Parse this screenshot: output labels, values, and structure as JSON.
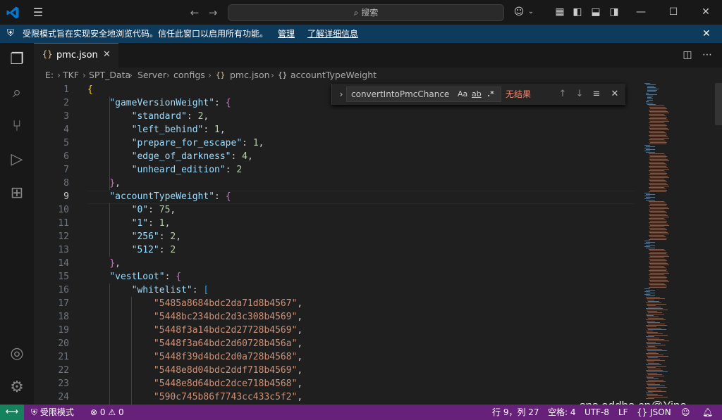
{
  "titlebar": {
    "search_placeholder": "搜索",
    "colors": {
      "logo": "#0078d4"
    }
  },
  "banner": {
    "message": "受限模式旨在实现安全地浏览代码。信任此窗口以启用所有功能。",
    "manage_link": "管理",
    "learn_more_link": "了解详细信息"
  },
  "tabs": [
    {
      "label": "pmc.json",
      "icon_text": "{}"
    }
  ],
  "breadcrumb": {
    "parts": [
      "E:",
      "TKF",
      "SPT_Data",
      "Server",
      "configs",
      "pmc.json",
      "accountTypeWeight"
    ]
  },
  "find": {
    "query": "convertIntoPmcChance",
    "case_label": "Aa",
    "word_label": "ab",
    "regex_label": ".*",
    "result": "无结果"
  },
  "editor": {
    "lines": [
      1,
      2,
      3,
      4,
      5,
      6,
      7,
      8,
      9,
      10,
      11,
      12,
      13,
      14,
      15,
      16,
      17,
      18,
      19,
      20,
      21,
      22,
      23,
      24
    ],
    "current_line": 9,
    "code": [
      "{",
      "\"gameVersionWeight\": {",
      "\"standard\": 2,",
      "\"left_behind\": 1,",
      "\"prepare_for_escape\": 1,",
      "\"edge_of_darkness\": 4,",
      "\"unheard_edition\": 2",
      "},",
      "\"accountTypeWeight\": {",
      "\"0\": 75,",
      "\"1\": 1,",
      "\"256\": 2,",
      "\"512\": 2",
      "},",
      "\"vestLoot\": {",
      "\"whitelist\": [",
      "\"5485a8684bdc2da71d8b4567\",",
      "\"5448bc234bdc2d3c308b4569\",",
      "\"5448f3a14bdc2d27728b4569\",",
      "\"5448f3a64bdc2d60728b456a\",",
      "\"5448f39d4bdc2d0a728b4568\",",
      "\"5448e8d04bdc2ddf718b4569\",",
      "\"5448e8d64bdc2dce718b4568\",",
      "\"590c745b86f7743cc433c5f2\","
    ]
  },
  "statusbar": {
    "restricted_mode": "受限模式",
    "errors": "0",
    "warnings": "0",
    "position": "行 9，列 27",
    "spaces": "空格: 4",
    "encoding": "UTF-8",
    "eol": "LF",
    "language": "JSON",
    "colors": {
      "background": "#68217a",
      "remote": "#16825d"
    }
  },
  "watermark": "sns.oddba.cn@Yino"
}
